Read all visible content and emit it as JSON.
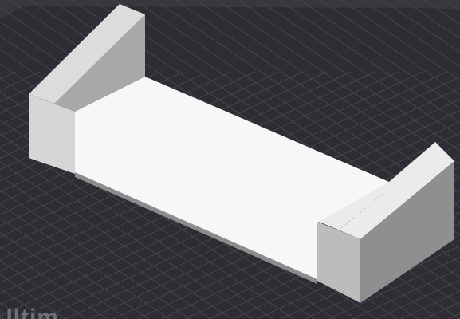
{
  "viewport": {
    "bed_label": "Ultim",
    "colors": {
      "background": "#2d2d33",
      "grid_line": "#45454d",
      "bed_top_edge": "#3a3a40",
      "model_floor": "#f7f7f7",
      "model_wall_light": "#ebebeb",
      "model_wall_mid": "#cfcfcf",
      "model_wall_shade": "#9a9a9a",
      "model_wall_dark": "#8a8a8a",
      "model_outline": "#7a7a7a",
      "label": "#6f6f78"
    },
    "model": {
      "name": "tray-model",
      "selected": false
    }
  }
}
